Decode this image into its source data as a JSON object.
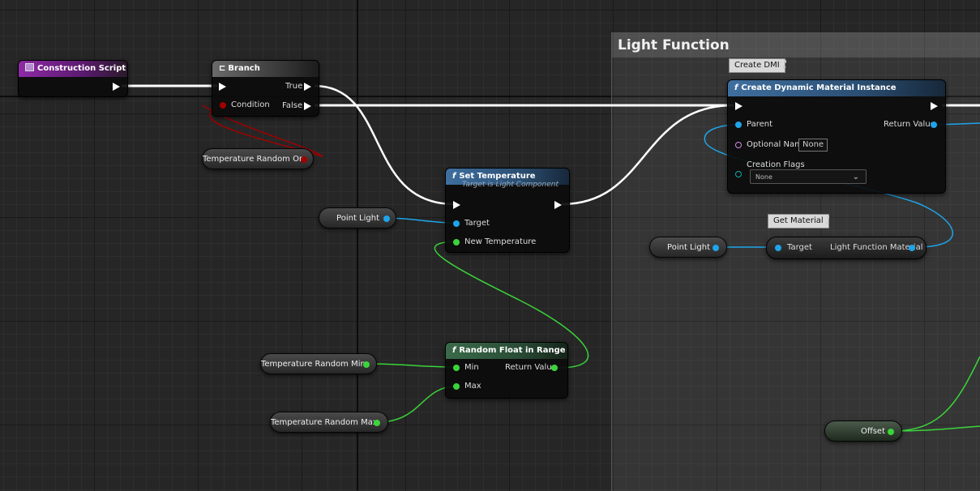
{
  "comment": {
    "title": "Light Function"
  },
  "nodes": {
    "construction_script": {
      "title": "Construction Script"
    },
    "branch": {
      "title": "Branch",
      "pin_condition": "Condition",
      "pin_true": "True",
      "pin_false": "False"
    },
    "set_temperature": {
      "title": "Set Temperature",
      "subtitle": "Target is Light Component",
      "pin_target": "Target",
      "pin_new_temperature": "New Temperature"
    },
    "random_float": {
      "title": "Random Float in Range",
      "pin_min": "Min",
      "pin_max": "Max",
      "pin_return": "Return Value"
    },
    "create_dmi": {
      "title": "Create Dynamic Material Instance",
      "pin_parent": "Parent",
      "pin_return": "Return Value",
      "pin_optional_name": "Optional Name",
      "optional_name_value": "None",
      "pin_creation_flags": "Creation Flags",
      "creation_flags_value": "None"
    },
    "get_material": {
      "pin_target": "Target",
      "pin_output": "Light Function Material"
    }
  },
  "variables": {
    "temperature_random_on": "Temperature Random On",
    "point_light_1": "Point Light",
    "point_light_2": "Point Light",
    "temperature_random_min": "Temperature Random Min",
    "temperature_random_max": "Temperature Random Max",
    "offset": "Offset"
  },
  "bubbles": {
    "create_dmi": "Create DMI",
    "get_material": "Get Material"
  },
  "icons": {
    "function": "f-function-icon",
    "branch": "branch-icon",
    "event": "event-icon"
  },
  "colors": {
    "object_pin": "#1fa4e8",
    "float_pin": "#3ad43a",
    "bool_pin": "#a10000",
    "exec": "#ffffff"
  }
}
